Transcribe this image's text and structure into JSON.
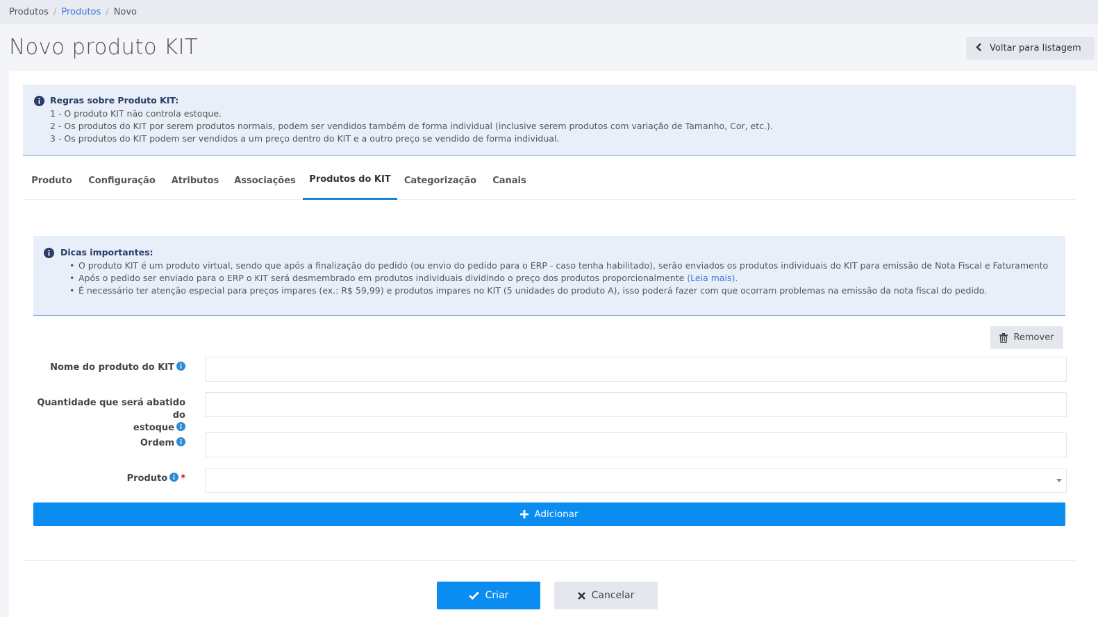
{
  "breadcrumb": {
    "items": [
      "Produtos",
      "Produtos",
      "Novo"
    ]
  },
  "page": {
    "title": "Novo produto KIT",
    "back_label": "Voltar para listagem"
  },
  "rules": {
    "title": "Regras sobre Produto KIT:",
    "lines": [
      "1 - O produto KIT não controla estoque.",
      "2 - Os produtos do KIT por serem produtos normais, podem ser vendidos também de forma individual (inclusive serem produtos com variação de Tamanho, Cor, etc.).",
      "3 - Os produtos do KIT podem ser vendidos a um preço dentro do KIT e a outro preço se vendido de forma individual."
    ]
  },
  "tabs": [
    "Produto",
    "Configuração",
    "Atributos",
    "Associações",
    "Produtos do KIT",
    "Categorização",
    "Canais"
  ],
  "active_tab": "Produtos do KIT",
  "tips": {
    "title": "Dicas importantes:",
    "bullet1": "O produto KIT é um produto virtual, sendo que após a finalização do pedido (ou envio do pedido para o ERP - caso tenha habilitado), serão enviados os produtos individuais do KIT para emissão de Nota Fiscal e Faturamento",
    "bullet2": "Após o pedido ser enviado para o ERP o KIT será desmembrado em produtos individuais dividindo o preço dos produtos proporcionalmente",
    "bullet2_link": "(Leia mais)",
    "bullet2_end": ".",
    "bullet3": "É necessário ter atenção especial para preços impares (ex.: R$ 59,99) e produtos impares no KIT (5 unidades do produto A), isso poderá fazer com que ocorram problemas na emissão da nota fiscal do pedido."
  },
  "form": {
    "remove_label": "Remover",
    "nome_label": "Nome do produto do KIT",
    "nome_value": "",
    "quantidade_label_line1": "Quantidade que será abatido do",
    "quantidade_label_line2": "estoque",
    "quantidade_value": "",
    "ordem_label": "Ordem",
    "ordem_value": "",
    "produto_label": "Produto",
    "produto_required": "*",
    "produto_value": "",
    "add_label": "Adicionar"
  },
  "actions": {
    "create_label": "Criar",
    "cancel_label": "Cancelar"
  },
  "colors": {
    "primary": "#0a8cf0",
    "info_bg": "#e9eff8",
    "info_title": "#2b3c66",
    "link": "#3b76d6",
    "required": "#d0021b"
  },
  "icons": {
    "back": "chevron-left-icon",
    "info": "info-circle-icon",
    "remove": "trash-icon",
    "add": "plus-icon",
    "create": "check-icon",
    "cancel": "times-icon",
    "select": "caret-down-icon"
  }
}
